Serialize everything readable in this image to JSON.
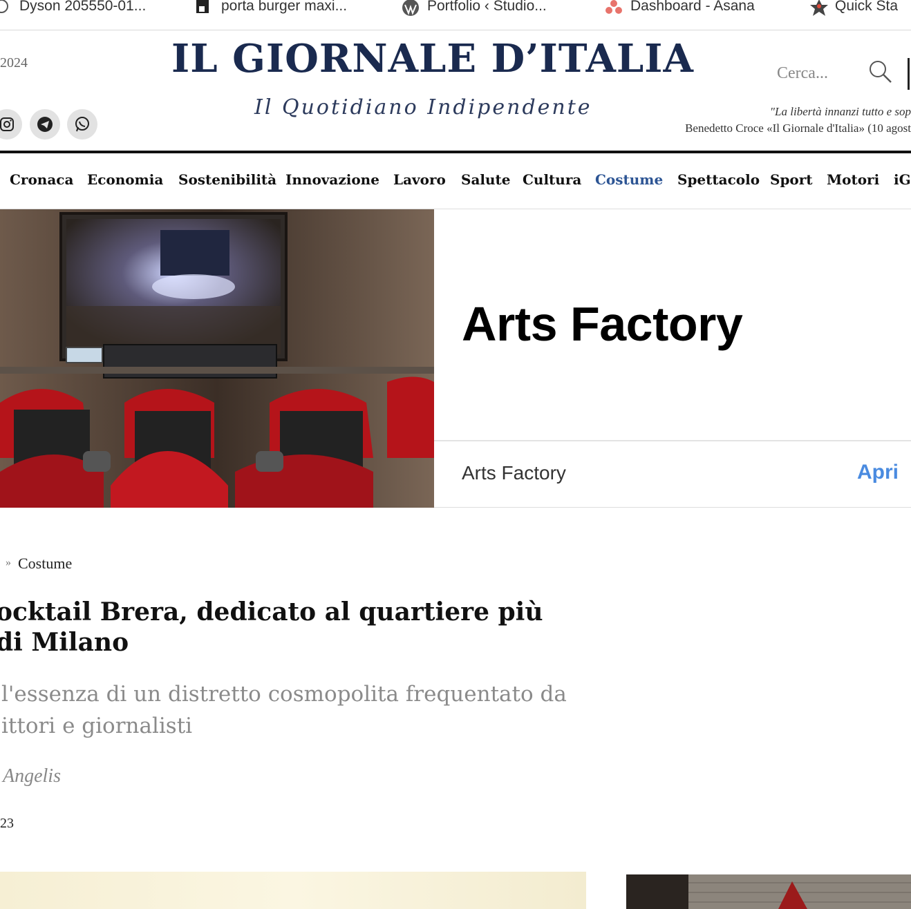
{
  "bookmarks": [
    {
      "label": "Dyson 205550-01...",
      "icon": "dyson-icon"
    },
    {
      "label": "porta burger maxi...",
      "icon": "page-favicon-icon"
    },
    {
      "label": "Portfolio ‹ Studio...",
      "icon": "wordpress-icon"
    },
    {
      "label": "Dashboard - Asana",
      "icon": "asana-icon"
    },
    {
      "label": "Quick Sta",
      "icon": "quickstart-icon"
    }
  ],
  "masthead": {
    "date": "2024",
    "logo": "IL GIORNALE D’ITALIA",
    "tagline": "Il Quotidiano Indipendente",
    "search_placeholder": "Cerca...",
    "quote": "\"La libertà innanzi tutto e sop",
    "quote_source": "Benedetto Croce «Il Giornale d'Italia» (10 agost"
  },
  "social": [
    "instagram-icon",
    "telegram-icon",
    "whatsapp-icon"
  ],
  "nav": {
    "items": [
      "Cronaca",
      "Economia",
      "Sostenibilità",
      "Innovazione",
      "Lavoro",
      "Salute",
      "Cultura",
      "Costume",
      "Spettacolo",
      "Sport",
      "Motori",
      "iG"
    ],
    "active": "Costume",
    "active_color": "#2d5594"
  },
  "ad": {
    "title": "Arts Factory",
    "subtitle": "Arts Factory",
    "cta": "Apri",
    "cta_color": "#4a8be0"
  },
  "article": {
    "breadcrumb_sep": "»",
    "breadcrumb": "Costume",
    "headline_line1": "ocktail Brera, dedicato al quartiere più",
    "headline_line2": "di Milano",
    "subhead_line1": "l'essenza di un distretto cosmopolita frequentato da",
    "subhead_line2": "ittori e giornalisti",
    "author": "Angelis",
    "date": "23"
  },
  "colors": {
    "logo": "#1a2a4f",
    "accent": "#2d5594"
  }
}
